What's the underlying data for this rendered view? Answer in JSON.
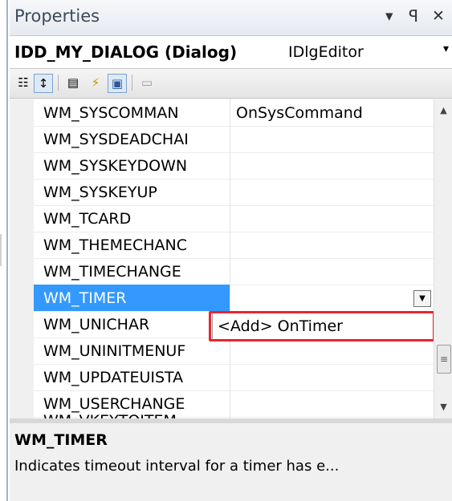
{
  "window": {
    "title": "Properties",
    "buttons": {
      "dropdown": "▾",
      "pin": "ᴾ",
      "close": "✕"
    }
  },
  "object": {
    "name": "IDD_MY_DIALOG (Dialog)",
    "type": "IDlgEditor",
    "dropdown_glyph": "▾"
  },
  "toolbar": {
    "items": [
      {
        "name": "categorized-icon",
        "glyph": "☷"
      },
      {
        "name": "alphabetical-icon",
        "glyph": "↕"
      },
      {
        "name": "properties-icon",
        "glyph": "▤"
      },
      {
        "name": "events-icon",
        "glyph": "⚡"
      },
      {
        "name": "messages-icon",
        "glyph": "▣"
      },
      {
        "name": "overrides-icon",
        "glyph": "▭"
      }
    ]
  },
  "grid": {
    "rows": [
      {
        "name": "WM_SYSCOMMAN",
        "value": "OnSysCommand"
      },
      {
        "name": "WM_SYSDEADCHAI",
        "value": ""
      },
      {
        "name": "WM_SYSKEYDOWN",
        "value": ""
      },
      {
        "name": "WM_SYSKEYUP",
        "value": ""
      },
      {
        "name": "WM_TCARD",
        "value": ""
      },
      {
        "name": "WM_THEMECHANC",
        "value": ""
      },
      {
        "name": "WM_TIMECHANGE",
        "value": ""
      },
      {
        "name": "WM_TIMER",
        "value": ""
      },
      {
        "name": "WM_UNICHAR",
        "value": ""
      },
      {
        "name": "WM_UNINITMENUF",
        "value": ""
      },
      {
        "name": "WM_UPDATEUISTA",
        "value": ""
      },
      {
        "name": "WM_USERCHANGE",
        "value": ""
      },
      {
        "name": "WM_VKEYTOITEM",
        "value": ""
      }
    ],
    "selected_index": 7,
    "dropdown_option": "<Add> OnTimer",
    "combo_glyph": "▼"
  },
  "scrollbar": {
    "up": "▲",
    "down": "▼",
    "thumb": "≡"
  },
  "description": {
    "title": "WM_TIMER",
    "text": "Indicates timeout interval for a timer has e..."
  },
  "colors": {
    "selection": "#3399ff",
    "highlight_border": "#e8262d"
  }
}
